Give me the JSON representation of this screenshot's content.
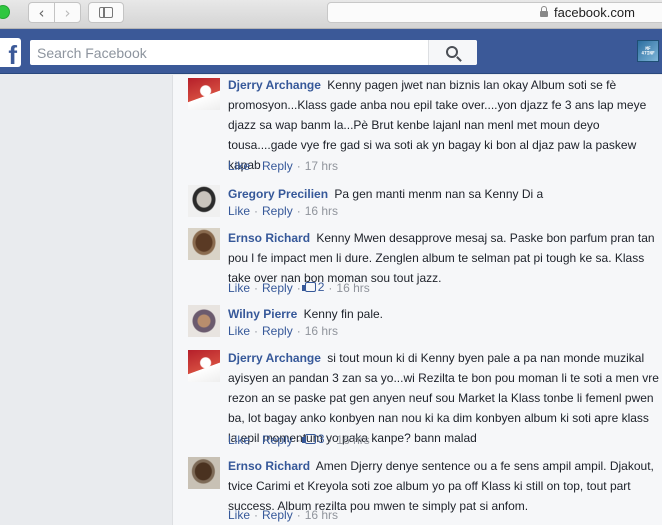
{
  "browser": {
    "url": "facebook.com",
    "back_glyph": "‹",
    "forward_glyph": "›"
  },
  "facebook": {
    "logo_letter": "f",
    "search_placeholder": "Search Facebook",
    "profile_badge": "MF 47INF"
  },
  "comments": [
    {
      "author": "Djerry Archange",
      "text": "Kenny pagen jwet nan biznis lan okay Album soti se fè promosyon...Klass gade anba nou epil take over....yon djazz fe 3 ans lap meye djazz sa wap banm la...Pè Brut kenbe lajanl nan menl met moun deyo tousa....gade vye fre gad si wa soti ak yn bagay ki bon al djaz paw la paskew kapab",
      "like_label": "Like",
      "reply_label": "Reply",
      "likes": "",
      "time": "17 hrs"
    },
    {
      "author": "Gregory Precilien",
      "text": "Pa gen manti menm nan sa Kenny Di a",
      "like_label": "Like",
      "reply_label": "Reply",
      "likes": "",
      "time": "16 hrs"
    },
    {
      "author": "Ernso Richard",
      "text": "Kenny Mwen desapprove mesaj sa. Paske bon parfum pran tan pou l fe impact men li dure. Zenglen album te selman pat pi tough ke sa. Klass take over nan bon moman sou tout jazz.",
      "like_label": "Like",
      "reply_label": "Reply",
      "likes": "2",
      "time": "16 hrs"
    },
    {
      "author": "Wilny Pierre",
      "text": "Kenny fin pale.",
      "like_label": "Like",
      "reply_label": "Reply",
      "likes": "",
      "time": "16 hrs"
    },
    {
      "author": "Djerry Archange",
      "text": "si tout moun ki di Kenny byen pale a pa nan monde muzikal ayisyen an pandan 3 zan sa yo...wi Rezilta te bon pou moman li te soti a men vre rezon an se paske pat gen anyen neuf sou Market la Klass tonbe li femenl pwen ba, lot bagay anko konbyen nan nou ki ka dim konbyen album ki soti apre klass la epil momentum yo paka kanpe? bann malad",
      "like_label": "Like",
      "reply_label": "Reply",
      "likes": "3",
      "time": "16 hrs"
    },
    {
      "author": "Ernso Richard",
      "text": "Amen Djerry denye sentence ou a fe sens ampil ampil. Djakout, tvice Carimi et Kreyola soti zoe album yo pa off Klass ki still on top, tout part success. Album rezilta pou mwen te simply pat si anfom.",
      "like_label": "Like",
      "reply_label": "Reply",
      "likes": "",
      "time": "16 hrs"
    }
  ]
}
